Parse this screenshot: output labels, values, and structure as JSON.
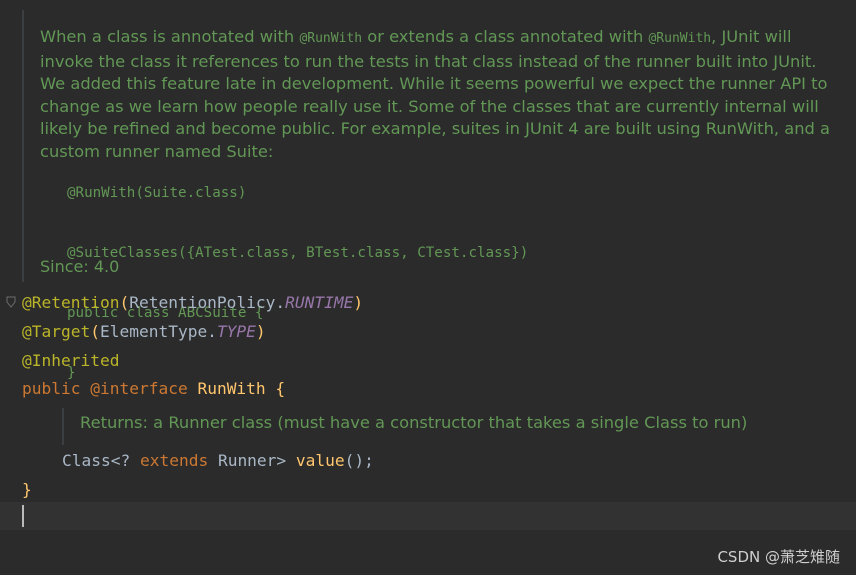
{
  "javadoc": {
    "intro_prefix": "When a class is annotated with",
    "runwith_tag_1": "@RunWith",
    "intro_mid": "or extends a class annotated with",
    "runwith_tag_2": "@RunWith",
    "intro_rest": ", JUnit will invoke the class it references to run the tests in that class instead of the runner built into JUnit. We added this feature late in development. While it seems powerful we expect the runner API to change as we learn how people really use it. Some of the classes that are currently internal will likely be refined and become public. For example, suites in JUnit 4 are built using RunWith, and a custom runner named Suite:",
    "example_lines": [
      "@RunWith(Suite.class)",
      "@SuiteClasses({ATest.class, BTest.class, CTest.class})",
      "public class ABCSuite {",
      "}"
    ],
    "since_label": "Since:",
    "since_value": "4.0"
  },
  "code": {
    "retention_ann": "@Retention",
    "retention_open": "(",
    "retention_class": "RetentionPolicy.",
    "retention_const": "RUNTIME",
    "retention_close": ")",
    "target_ann": "@Target",
    "target_open": "(",
    "target_class": "ElementType.",
    "target_const": "TYPE",
    "target_close": ")",
    "inherited_ann": "@Inherited",
    "public_kw": "public",
    "interface_ann_kw": "@interface",
    "interface_name": "RunWith",
    "interface_open": " {",
    "returns_doc": "Returns: a Runner class (must have a constructor that takes a single Class to run)",
    "method_type_start": "Class<? ",
    "extends_kw": "extends",
    "method_type_end": " Runner> ",
    "method_name": "value",
    "method_tail": "();",
    "close_brace": "}"
  },
  "watermark": "CSDN @萧芝雉随",
  "colors": {
    "background": "#2b2b2b",
    "doc_comment": "#629755",
    "annotation": "#bbb529",
    "keyword": "#cc7832",
    "constant": "#9876aa",
    "method": "#ffc66d",
    "plain": "#a9b7c6"
  }
}
